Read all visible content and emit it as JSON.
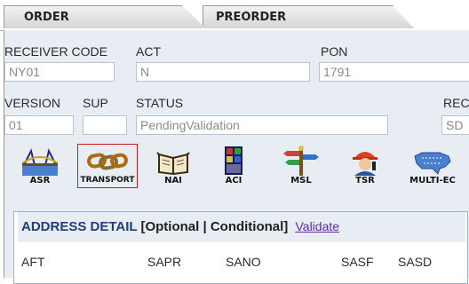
{
  "tabs": {
    "order": "ORDER",
    "preorder": "PREORDER"
  },
  "fields": {
    "receiver_code": {
      "label": "RECEIVER CODE",
      "value": "NY01"
    },
    "act": {
      "label": "ACT",
      "value": "N"
    },
    "pon": {
      "label": "PON",
      "value": "1791"
    },
    "version": {
      "label": "VERSION",
      "value": "01"
    },
    "sup": {
      "label": "SUP",
      "value": ""
    },
    "status": {
      "label": "STATUS",
      "value": "PendingValidation"
    },
    "rec": {
      "label": "REC",
      "value": "SD"
    }
  },
  "icons": [
    {
      "label": "ASR",
      "icon": "bridge-icon"
    },
    {
      "label": "TRANSPORT",
      "icon": "chain-icon",
      "selected": true
    },
    {
      "label": "NAI",
      "icon": "book-icon"
    },
    {
      "label": "ACI",
      "icon": "panel-icon"
    },
    {
      "label": "MSL",
      "icon": "signpost-icon"
    },
    {
      "label": "TSR",
      "icon": "technician-icon"
    },
    {
      "label": "MULTI-EC",
      "icon": "usa-map-icon"
    }
  ],
  "address_detail": {
    "title": "ADDRESS DETAIL",
    "qualifier": "[Optional | Conditional]",
    "validate_link": "Validate",
    "columns": [
      "AFT",
      "SAPR",
      "SANO",
      "SASF",
      "SASD"
    ]
  },
  "colors": {
    "selected_border": "#d01a1a",
    "section_title": "#1f3d7a",
    "link": "#5b2da0",
    "panel_bg": "#e8ecf3"
  }
}
